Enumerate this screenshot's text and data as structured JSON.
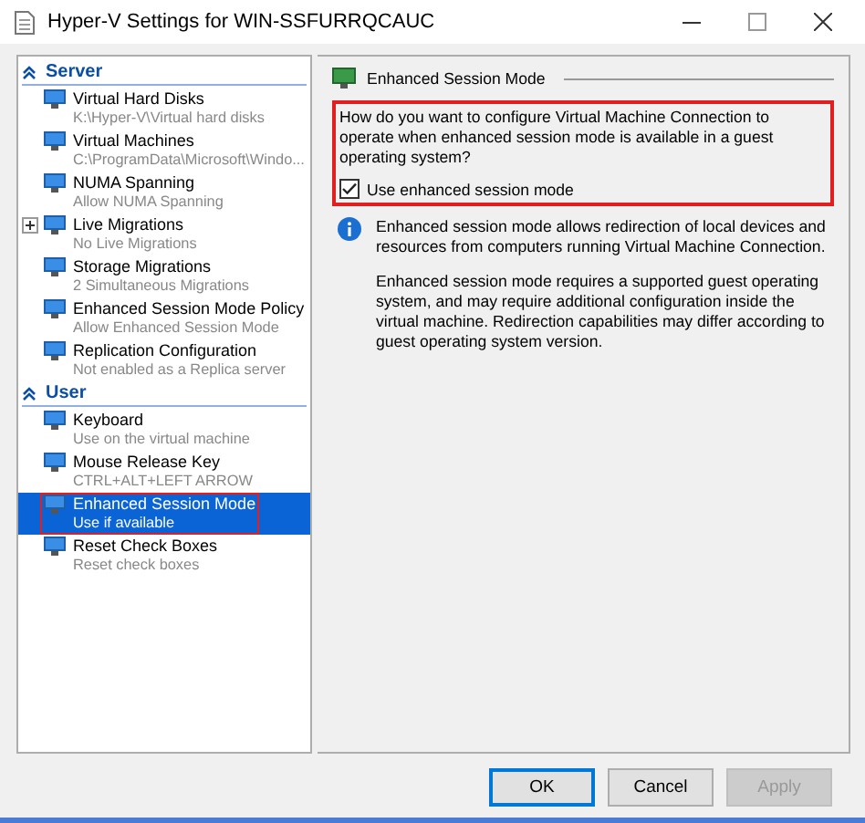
{
  "window": {
    "title": "Hyper-V Settings for WIN-SSFURRQCAUC"
  },
  "sections": [
    {
      "label": "Server",
      "expanded": true,
      "items": [
        {
          "title": "Virtual Hard Disks",
          "subtitle": "K:\\Hyper-V\\Virtual hard disks",
          "selected": false,
          "highlighted": false,
          "has_children": false
        },
        {
          "title": "Virtual Machines",
          "subtitle": "C:\\ProgramData\\Microsoft\\Windo...",
          "selected": false,
          "highlighted": false,
          "has_children": false
        },
        {
          "title": "NUMA Spanning",
          "subtitle": "Allow NUMA Spanning",
          "selected": false,
          "highlighted": false,
          "has_children": false
        },
        {
          "title": "Live Migrations",
          "subtitle": "No Live Migrations",
          "selected": false,
          "highlighted": false,
          "has_children": true
        },
        {
          "title": "Storage Migrations",
          "subtitle": "2 Simultaneous Migrations",
          "selected": false,
          "highlighted": false,
          "has_children": false
        },
        {
          "title": "Enhanced Session Mode Policy",
          "subtitle": "Allow Enhanced Session Mode",
          "selected": false,
          "highlighted": false,
          "has_children": false
        },
        {
          "title": "Replication Configuration",
          "subtitle": "Not enabled as a Replica server",
          "selected": false,
          "highlighted": false,
          "has_children": false
        }
      ]
    },
    {
      "label": "User",
      "expanded": true,
      "items": [
        {
          "title": "Keyboard",
          "subtitle": "Use on the virtual machine",
          "selected": false,
          "highlighted": false,
          "has_children": false
        },
        {
          "title": "Mouse Release Key",
          "subtitle": "CTRL+ALT+LEFT ARROW",
          "selected": false,
          "highlighted": false,
          "has_children": false
        },
        {
          "title": "Enhanced Session Mode",
          "subtitle": "Use if available",
          "selected": true,
          "highlighted": true,
          "has_children": false
        },
        {
          "title": "Reset Check Boxes",
          "subtitle": "Reset check boxes",
          "selected": false,
          "highlighted": false,
          "has_children": false
        }
      ]
    }
  ],
  "detail": {
    "heading": "Enhanced Session Mode",
    "highlighted": true,
    "question": "How do you want to configure Virtual Machine Connection to operate when enhanced session mode is available in a guest operating system?",
    "checkbox": {
      "label": "Use enhanced session mode",
      "checked": true
    },
    "info": [
      "Enhanced session mode allows redirection of local devices and resources from computers running Virtual Machine Connection.",
      "Enhanced session mode requires a supported guest operating system, and may require additional configuration inside the virtual machine. Redirection capabilities may differ according to guest operating system version."
    ]
  },
  "buttons": [
    {
      "label": "OK",
      "disabled": false,
      "default": true
    },
    {
      "label": "Cancel",
      "disabled": false,
      "default": false
    },
    {
      "label": "Apply",
      "disabled": true,
      "default": false
    }
  ]
}
